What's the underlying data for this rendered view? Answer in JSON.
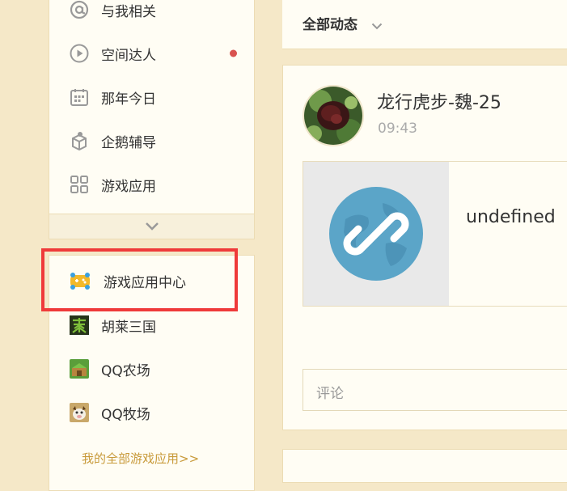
{
  "sidebar": {
    "menu_items": [
      {
        "label": "与我相关",
        "icon": "at-sign-icon"
      },
      {
        "label": "空间达人",
        "icon": "play-circle-icon",
        "has_dot": true
      },
      {
        "label": "那年今日",
        "icon": "calendar-icon"
      },
      {
        "label": "企鹅辅导",
        "icon": "penguin-box-icon"
      },
      {
        "label": "游戏应用",
        "icon": "grid-apps-icon"
      }
    ],
    "expand_icon": "chevron-down-icon",
    "games": [
      {
        "label": "游戏应用中心",
        "icon": "gamepad-icon"
      },
      {
        "label": "胡莱三国",
        "icon": "hulai-sanguo-icon"
      },
      {
        "label": "QQ农场",
        "icon": "qq-farm-icon"
      },
      {
        "label": "QQ牧场",
        "icon": "qq-ranch-icon"
      }
    ],
    "all_games_link": "我的全部游戏应用>>",
    "highlight_color": "#ef3a3a"
  },
  "feed": {
    "filter_label": "全部动态",
    "post": {
      "author": "龙行虎步-魏-25",
      "time": "09:43",
      "link_title": "undefined",
      "link_icon": "link-globe-icon",
      "comment_placeholder": "评论"
    }
  }
}
